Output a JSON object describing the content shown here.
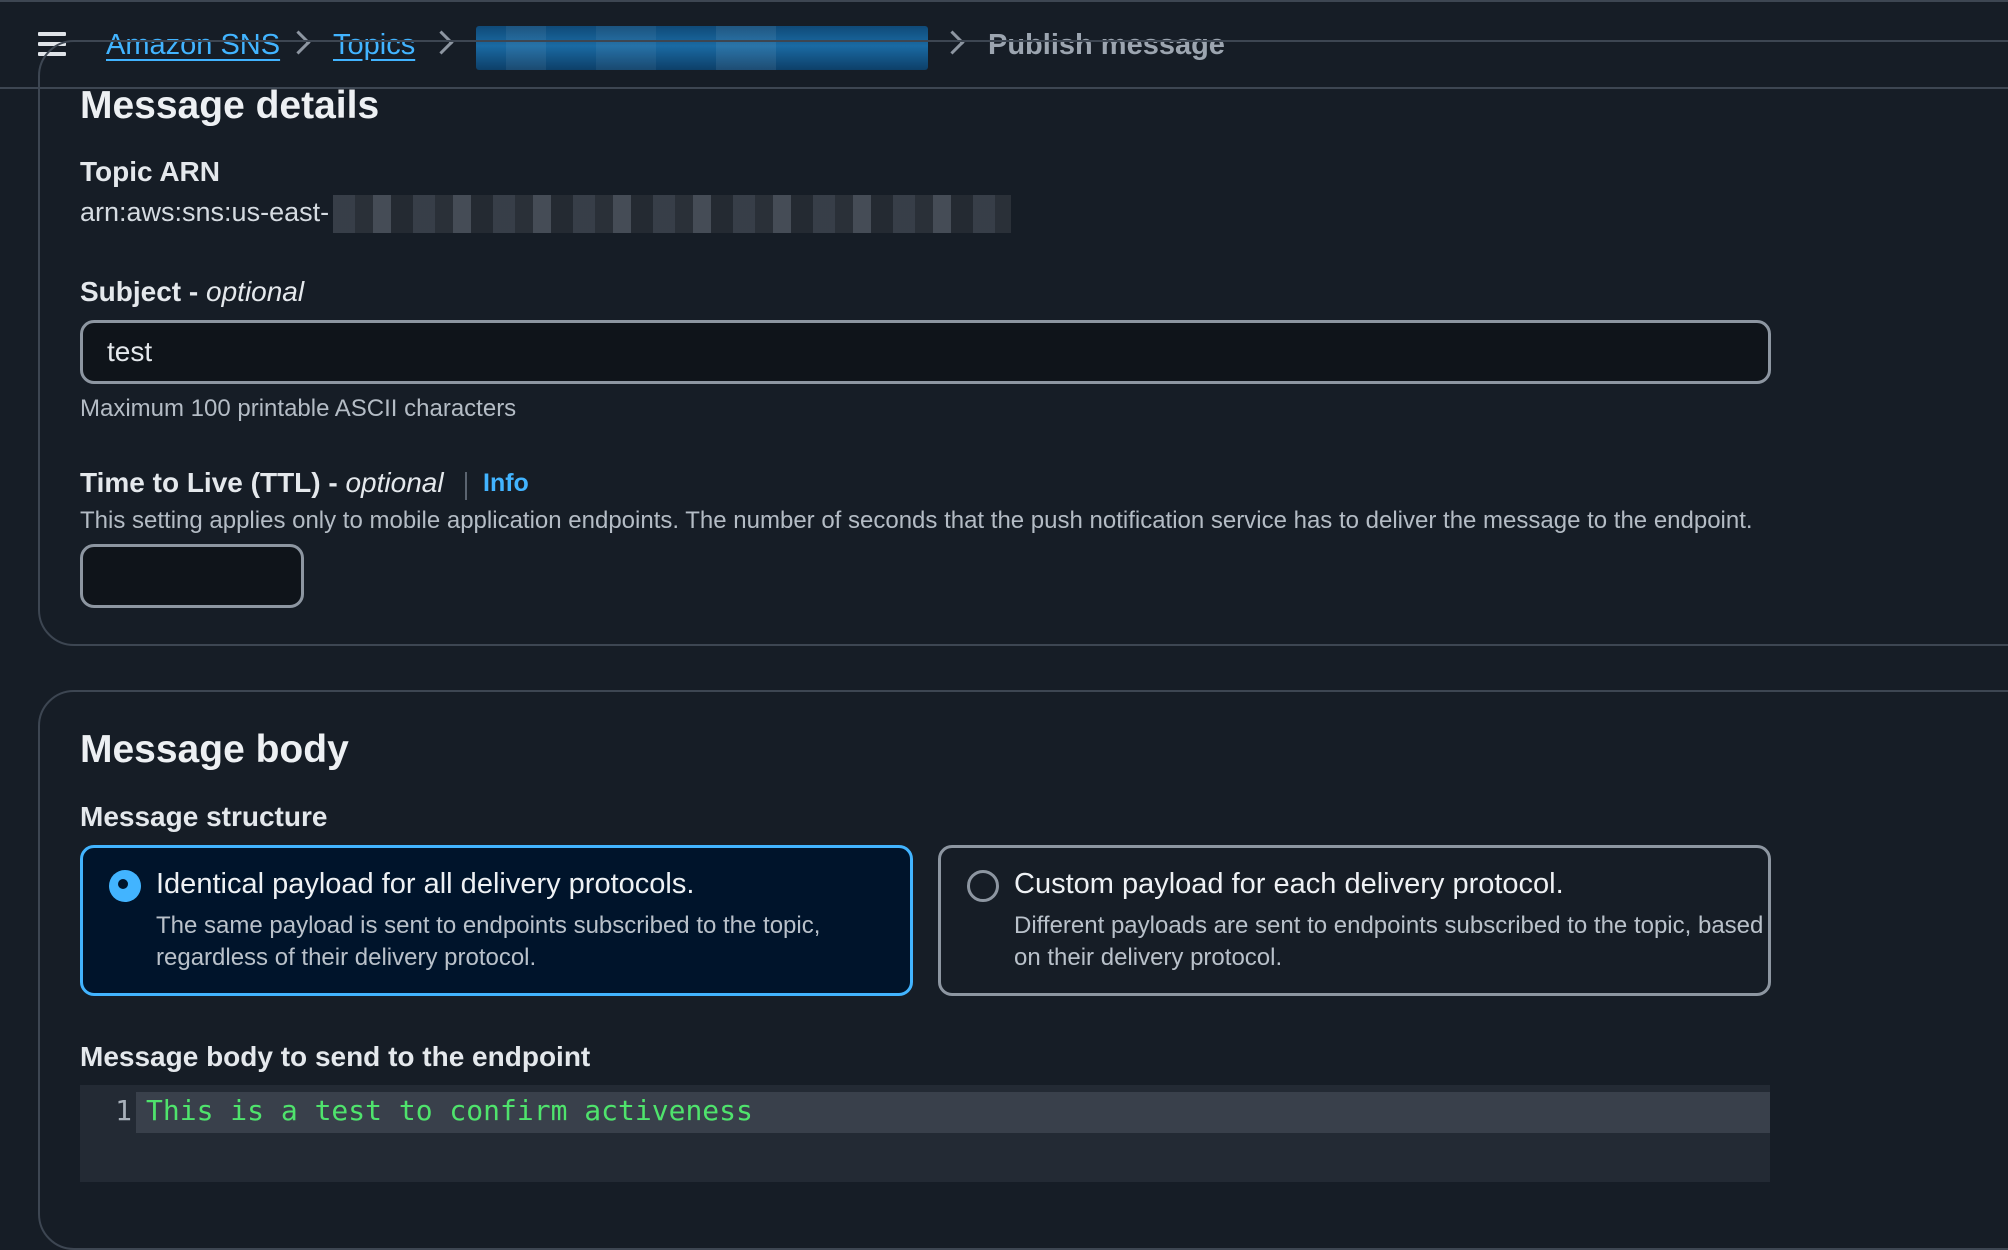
{
  "breadcrumb": {
    "items": [
      {
        "label": "Amazon SNS"
      },
      {
        "label": "Topics"
      },
      {
        "label": "Publish message"
      }
    ]
  },
  "message_details": {
    "heading": "Message details",
    "topic_arn_label": "Topic ARN",
    "topic_arn_value": "arn:aws:sns:us-east-",
    "subject_label": "Subject - ",
    "subject_optional": "optional",
    "subject_value": "test",
    "subject_hint": "Maximum 100 printable ASCII characters",
    "ttl_label": "Time to Live (TTL) - ",
    "ttl_optional": "optional",
    "ttl_info": "Info",
    "ttl_description": "This setting applies only to mobile application endpoints. The number of seconds that the push notification service has to deliver the message to the endpoint.",
    "ttl_value": ""
  },
  "message_body": {
    "heading": "Message body",
    "structure_label": "Message structure",
    "options": [
      {
        "title": "Identical payload for all delivery protocols.",
        "description": "The same payload is sent to endpoints subscribed to the topic, regardless of their delivery protocol.",
        "selected": true
      },
      {
        "title": "Custom payload for each delivery protocol.",
        "description": "Different payloads are sent to endpoints subscribed to the topic, based on their delivery protocol.",
        "selected": false
      }
    ],
    "body_label": "Message body to send to the endpoint",
    "editor": {
      "line_number": "1",
      "code": "This is a test to confirm activeness"
    }
  },
  "colors": {
    "background": "#161d26",
    "accent": "#42b4ff",
    "code_text": "#4fe36c"
  }
}
